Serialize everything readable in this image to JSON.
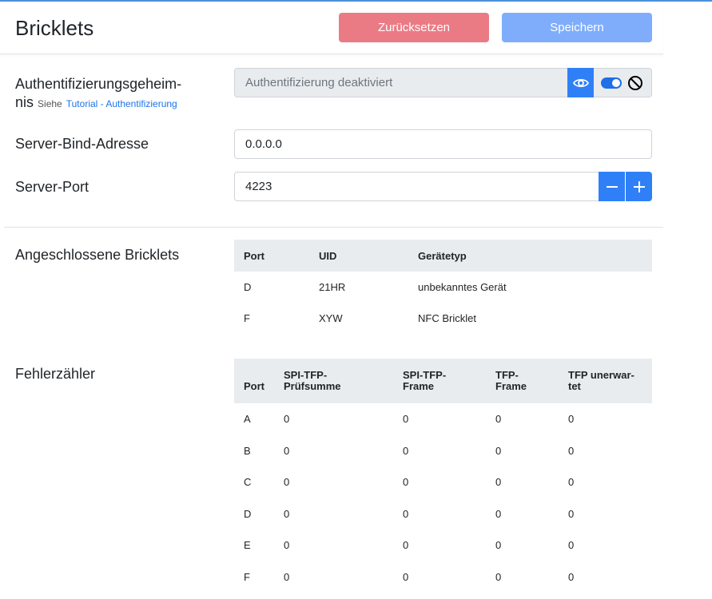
{
  "header": {
    "title": "Bricklets",
    "reset_label": "Zurücksetzen",
    "save_label": "Speichern"
  },
  "auth": {
    "label_line1": "Authentifizierungsgeheim-",
    "label_line2": "nis",
    "hint": "Siehe",
    "link": "Tutorial - Authentifizierung",
    "placeholder": "Authentifizierung deaktiviert",
    "enabled": true
  },
  "bind": {
    "label": "Server-Bind-Adresse",
    "value": "0.0.0.0"
  },
  "port": {
    "label": "Server-Port",
    "value": "4223",
    "minus": "−",
    "plus": "+"
  },
  "connected": {
    "label": "Angeschlossene Bricklets",
    "columns": [
      "Port",
      "UID",
      "Gerätetyp"
    ],
    "rows": [
      [
        "D",
        "21HR",
        "unbekanntes Gerät"
      ],
      [
        "F",
        "XYW",
        "NFC Bricklet"
      ]
    ]
  },
  "errors": {
    "label": "Fehlerzähler",
    "columns": [
      {
        "line1": "",
        "line2": "Port"
      },
      {
        "line1": "SPI-TFP-",
        "line2": "Prüfsumme"
      },
      {
        "line1": "SPI-TFP-",
        "line2": "Frame"
      },
      {
        "line1": "TFP-",
        "line2": "Frame"
      },
      {
        "line1": "TFP unerwar-",
        "line2": "tet"
      }
    ],
    "rows": [
      [
        "A",
        "0",
        "0",
        "0",
        "0"
      ],
      [
        "B",
        "0",
        "0",
        "0",
        "0"
      ],
      [
        "C",
        "0",
        "0",
        "0",
        "0"
      ],
      [
        "D",
        "0",
        "0",
        "0",
        "0"
      ],
      [
        "E",
        "0",
        "0",
        "0",
        "0"
      ],
      [
        "F",
        "0",
        "0",
        "0",
        "0"
      ]
    ]
  },
  "colors": {
    "danger": "#ea7b85",
    "primary": "#7fadfb",
    "accent": "#2f80f7"
  },
  "icons": [
    "eye-icon",
    "ban-icon",
    "minus-icon",
    "plus-icon"
  ]
}
